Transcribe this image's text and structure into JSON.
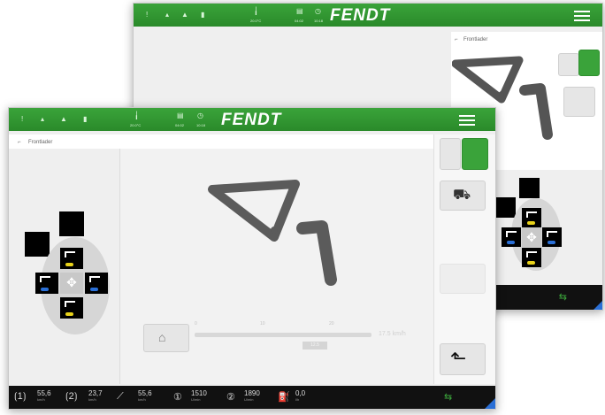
{
  "brand": "FENDT",
  "section_title": "Frontlader",
  "topbar": {
    "temp": "20.0°C",
    "status": "04:02",
    "time": "10:18"
  },
  "slider": {
    "ticks": [
      "0",
      "10",
      "20"
    ],
    "readout": "17.5 km/h",
    "value_box": "12.5"
  },
  "bottom": {
    "items": [
      {
        "value": "55,6",
        "unit": "km/h"
      },
      {
        "value": "23,7",
        "unit": "km/h"
      },
      {
        "value": "55,6",
        "unit": "km/h"
      },
      {
        "value": "1510",
        "unit": "U/min"
      },
      {
        "value": "1890",
        "unit": "U/min"
      },
      {
        "value": "0,0",
        "unit": "l/h"
      }
    ]
  },
  "colors": {
    "green": "#3aa33a",
    "dark": "#111111",
    "yellow": "#e8d21a",
    "blue": "#2a6fd6"
  }
}
